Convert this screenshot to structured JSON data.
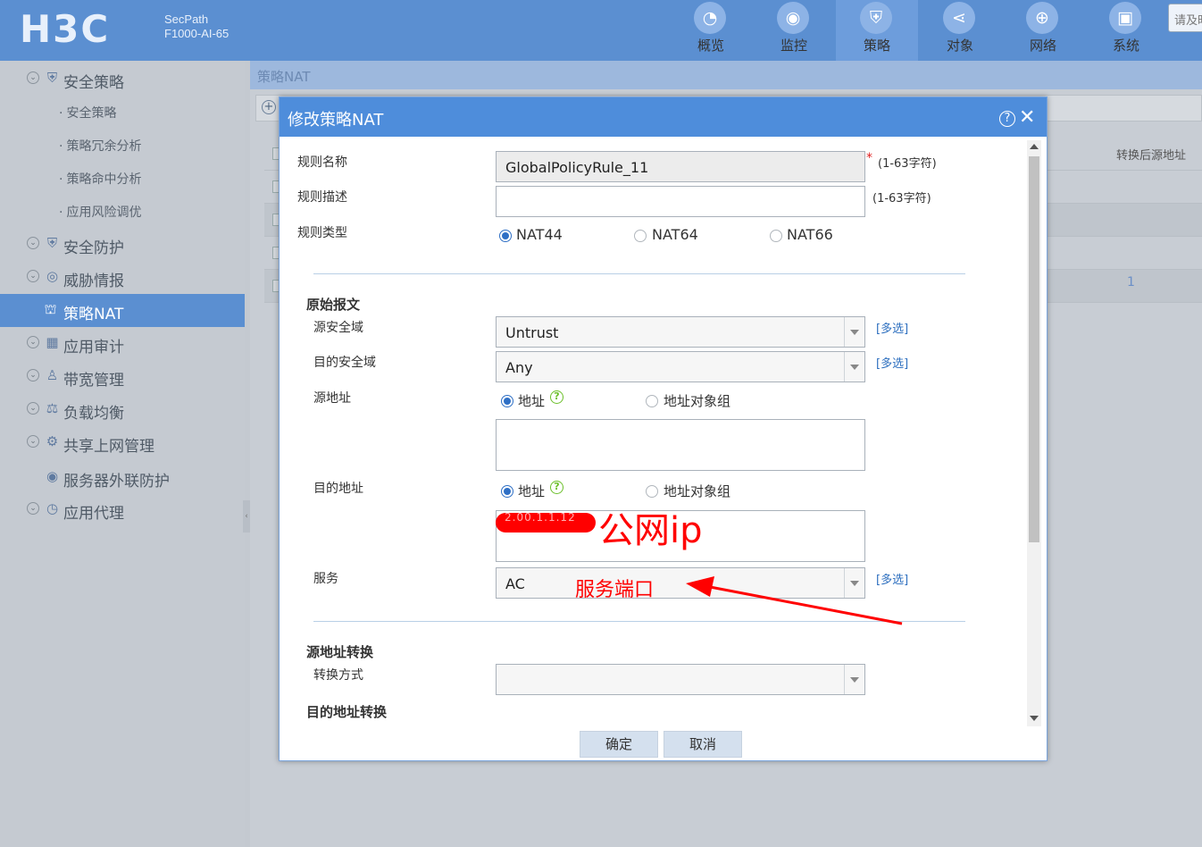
{
  "header": {
    "logo": "H3C",
    "product_line1": "SecPath",
    "product_line2": "F1000-AI-65",
    "nav": [
      {
        "label": "概览",
        "icon": "dashboard-icon"
      },
      {
        "label": "监控",
        "icon": "monitor-icon"
      },
      {
        "label": "策略",
        "icon": "policy-shield-icon",
        "active": true
      },
      {
        "label": "对象",
        "icon": "share-nodes-icon"
      },
      {
        "label": "网络",
        "icon": "globe-icon"
      },
      {
        "label": "系统",
        "icon": "system-monitor-icon"
      }
    ],
    "search_placeholder": "请及时"
  },
  "sidebar": {
    "items": [
      {
        "label": "安全策略",
        "icon": "shield-icon"
      },
      {
        "label": "安全策略",
        "sub": true
      },
      {
        "label": "策略冗余分析",
        "sub": true
      },
      {
        "label": "策略命中分析",
        "sub": true
      },
      {
        "label": "应用风险调优",
        "sub": true
      },
      {
        "label": "安全防护",
        "icon": "shield-icon"
      },
      {
        "label": "威胁情报",
        "icon": "eye-icon"
      },
      {
        "label": "策略NAT",
        "icon": "nat-icon",
        "active": true
      },
      {
        "label": "应用审计",
        "icon": "grid-icon"
      },
      {
        "label": "带宽管理",
        "icon": "users-icon"
      },
      {
        "label": "负载均衡",
        "icon": "balance-icon"
      },
      {
        "label": "共享上网管理",
        "icon": "share-icon"
      },
      {
        "label": "服务器外联防护",
        "icon": "server-shield-icon"
      },
      {
        "label": "应用代理",
        "icon": "compass-icon"
      }
    ]
  },
  "main": {
    "breadcrumb": "策略NAT",
    "column_header": "转换后源地址",
    "row_value": "1"
  },
  "dialog": {
    "title": "修改策略NAT",
    "rule_name_label": "规则名称",
    "rule_name_value": "GlobalPolicyRule_11",
    "rule_name_hint": "(1-63字符)",
    "required_mark": "*",
    "rule_desc_label": "规则描述",
    "rule_desc_value": "",
    "rule_desc_hint": "(1-63字符)",
    "rule_type_label": "规则类型",
    "rule_types": [
      "NAT44",
      "NAT64",
      "NAT66"
    ],
    "original_packet_section": "原始报文",
    "src_zone_label": "源安全域",
    "src_zone_value": "Untrust",
    "dst_zone_label": "目的安全域",
    "dst_zone_value": "Any",
    "multi_select": "[多选]",
    "src_addr_label": "源地址",
    "dst_addr_label": "目的地址",
    "addr_option": "地址",
    "addr_group_option": "地址对象组",
    "service_label": "服务",
    "service_value": "AC",
    "src_translate_section": "源地址转换",
    "translate_mode_label": "转换方式",
    "dst_translate_section": "目的地址转换",
    "ok_button": "确定",
    "cancel_button": "取消"
  },
  "annotations": {
    "public_ip": "公网ip",
    "service_port": "服务端口",
    "redacted_text": "2.00.1.1.12"
  },
  "colors": {
    "header_blue": "#5b8fd1",
    "dialog_title_blue": "#4e8ddb",
    "annotation_red": "#ff0000",
    "link_blue": "#2d6fbf"
  }
}
